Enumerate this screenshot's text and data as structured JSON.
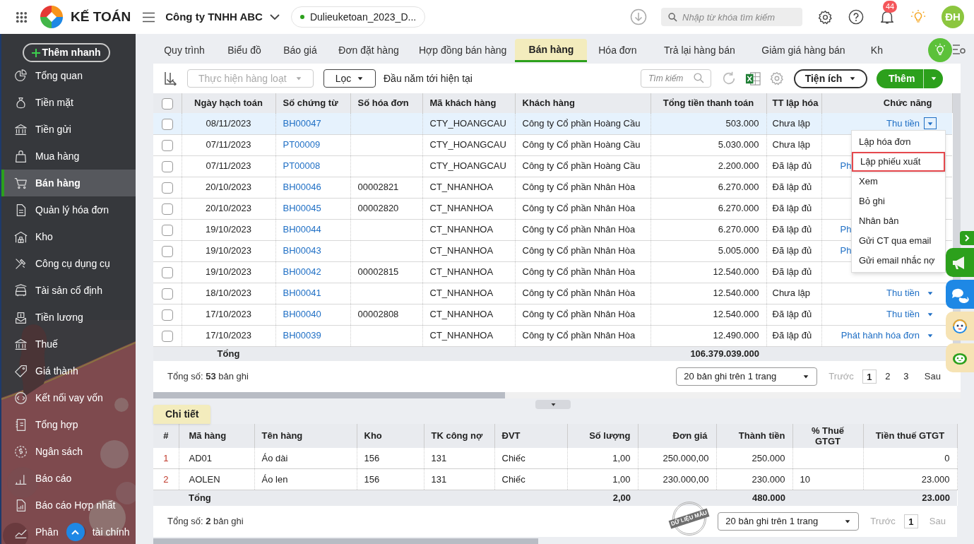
{
  "header": {
    "app_name": "KẾ TOÁN",
    "company": "Công ty TNHH ABC",
    "database": "Dulieuketoan_2023_D...",
    "search_placeholder": "Nhập từ khóa tìm kiếm",
    "notification_count": "44",
    "avatar": "ĐH"
  },
  "sidebar": {
    "quick_add": "Thêm nhanh",
    "items": [
      {
        "label": "Tổng quan",
        "selected": false
      },
      {
        "label": "Tiền mặt",
        "selected": false
      },
      {
        "label": "Tiền gửi",
        "selected": false
      },
      {
        "label": "Mua hàng",
        "selected": false
      },
      {
        "label": "Bán hàng",
        "selected": true
      },
      {
        "label": "Quản lý hóa đơn",
        "selected": false
      },
      {
        "label": "Kho",
        "selected": false
      },
      {
        "label": "Công cụ dụng cụ",
        "selected": false
      },
      {
        "label": "Tài sản cố định",
        "selected": false
      },
      {
        "label": "Tiền lương",
        "selected": false
      },
      {
        "label": "Thuế",
        "selected": false
      },
      {
        "label": "Giá thành",
        "selected": false
      },
      {
        "label": "Kết nối vay vốn",
        "selected": false
      },
      {
        "label": "Tổng hợp",
        "selected": false
      },
      {
        "label": "Ngân sách",
        "selected": false
      },
      {
        "label": "Báo cáo",
        "selected": false
      },
      {
        "label": "Báo cáo Hợp nhất",
        "selected": false
      },
      {
        "label": "Phân",
        "label_after": "tài chính",
        "selected": false
      }
    ]
  },
  "tabs": [
    {
      "label": "Quy trình",
      "selected": false
    },
    {
      "label": "Biểu đồ",
      "selected": false
    },
    {
      "label": "Báo giá",
      "selected": false
    },
    {
      "label": "Đơn đặt hàng",
      "selected": false
    },
    {
      "label": "Hợp đồng bán hàng",
      "selected": false
    },
    {
      "label": "Bán hàng",
      "selected": true
    },
    {
      "label": "Hóa đơn",
      "selected": false
    },
    {
      "label": "Trả lại hàng bán",
      "selected": false
    },
    {
      "label": "Giảm giá hàng bán",
      "selected": false
    },
    {
      "label": "Kh",
      "selected": false
    }
  ],
  "toolbar": {
    "batch": {
      "label": "Thực hiện hàng loạt",
      "disabled": true
    },
    "filter": "Lọc",
    "period": "Đầu năm tới hiện tại",
    "search_placeholder": "Tìm kiếm",
    "utilities": "Tiện ích",
    "add": "Thêm"
  },
  "table": {
    "header_checked": false,
    "columns": [
      "Ngày hạch toán",
      "Số chứng từ",
      "Số hóa đơn",
      "Mã khách hàng",
      "Khách hàng",
      "Tổng tiền thanh toán",
      "TT lập hóa",
      "Chức năng"
    ],
    "rows": [
      {
        "checked": false,
        "selected": true,
        "date": "08/11/2023",
        "doc": "BH00047",
        "invoice": "",
        "customer_code": "CTY_HOANGCAU",
        "customer": "Công ty Cổ phần Hoàng Cầu",
        "total": "503.000",
        "status": "Chưa lập",
        "action": "Thu tiền",
        "menu_open": true
      },
      {
        "checked": false,
        "selected": false,
        "date": "07/11/2023",
        "doc": "PT00009",
        "invoice": "",
        "customer_code": "CTY_HOANGCAU",
        "customer": "Công ty Cổ phần Hoàng Cầu",
        "total": "5.030.000",
        "status": "Chưa lập"
      },
      {
        "checked": false,
        "selected": false,
        "date": "07/11/2023",
        "doc": "PT00008",
        "invoice": "",
        "customer_code": "CTY_HOANGCAU",
        "customer": "Công ty Cổ phần Hoàng Cầu",
        "total": "2.200.000",
        "status": "Đã lập đủ",
        "action": "Ph"
      },
      {
        "checked": false,
        "selected": false,
        "date": "20/10/2023",
        "doc": "BH00046",
        "invoice": "00002821",
        "customer_code": "CT_NHANHOA",
        "customer": "Công ty Cổ phần Nhân Hòa",
        "total": "6.270.000",
        "status": "Đã lập đủ"
      },
      {
        "checked": false,
        "selected": false,
        "date": "20/10/2023",
        "doc": "BH00045",
        "invoice": "00002820",
        "customer_code": "CT_NHANHOA",
        "customer": "Công ty Cổ phần Nhân Hòa",
        "total": "6.270.000",
        "status": "Đã lập đủ"
      },
      {
        "checked": false,
        "selected": false,
        "date": "19/10/2023",
        "doc": "BH00044",
        "invoice": "",
        "customer_code": "CT_NHANHOA",
        "customer": "Công ty Cổ phần Nhân Hòa",
        "total": "6.270.000",
        "status": "Đã lập đủ",
        "action": "Ph"
      },
      {
        "checked": false,
        "selected": false,
        "date": "19/10/2023",
        "doc": "BH00043",
        "invoice": "",
        "customer_code": "CT_NHANHOA",
        "customer": "Công ty Cổ phần Nhân Hòa",
        "total": "5.005.000",
        "status": "Đã lập đủ",
        "action": "Ph"
      },
      {
        "checked": false,
        "selected": false,
        "date": "19/10/2023",
        "doc": "BH00042",
        "invoice": "00002815",
        "customer_code": "CT_NHANHOA",
        "customer": "Công ty Cổ phần Nhân Hòa",
        "total": "12.540.000",
        "status": "Đã lập đủ"
      },
      {
        "checked": false,
        "selected": false,
        "date": "18/10/2023",
        "doc": "BH00041",
        "invoice": "",
        "customer_code": "CT_NHANHOA",
        "customer": "Công ty Cổ phần Nhân Hòa",
        "total": "12.540.000",
        "status": "Chưa lập",
        "action": "Thu tiền",
        "menu_open": false
      },
      {
        "checked": false,
        "selected": false,
        "date": "17/10/2023",
        "doc": "BH00040",
        "invoice": "00002808",
        "customer_code": "CT_NHANHOA",
        "customer": "Công ty Cổ phần Nhân Hòa",
        "total": "12.540.000",
        "status": "Đã lập đủ",
        "action": "Thu tiền",
        "menu_open": false
      },
      {
        "checked": false,
        "selected": false,
        "date": "17/10/2023",
        "doc": "BH00039",
        "invoice": "",
        "customer_code": "CT_NHANHOA",
        "customer": "Công ty Cổ phần Nhân Hòa",
        "total": "12.490.000",
        "status": "Đã lập đủ",
        "action": "Phát hành hóa đơn",
        "menu_open": false
      }
    ],
    "total_label": "Tổng",
    "total_value": "106.379.039.000",
    "record_count": "Tổng số: **53** bản ghi",
    "page_size": "20 bản ghi trên 1 trang",
    "prev": "Trước",
    "pages": [
      {
        "label": "1",
        "selected": true
      },
      {
        "label": "2",
        "selected": false
      },
      {
        "label": "3",
        "selected": false
      }
    ],
    "next": "Sau"
  },
  "action_menu": {
    "items": [
      {
        "label": "Lập hóa đơn",
        "selected": false
      },
      {
        "label": "Lập phiếu xuất",
        "selected": true
      },
      {
        "label": "Xem",
        "selected": false
      },
      {
        "label": "Bỏ ghi",
        "selected": false
      },
      {
        "label": "Nhân bản",
        "selected": false
      },
      {
        "label": "Gửi CT qua email",
        "selected": false
      },
      {
        "label": "Gửi email nhắc nợ",
        "selected": false
      }
    ]
  },
  "detail": {
    "tab": "Chi tiết",
    "columns": [
      "#",
      "Mã hàng",
      "Tên hàng",
      "Kho",
      "TK công nợ",
      "ĐVT",
      "Số lượng",
      "Đơn giá",
      "Thành tiền",
      "% Thuế GTGT",
      "Tiền thuế GTGT"
    ],
    "rows": [
      [
        "1",
        "AD01",
        "Áo dài",
        "156",
        "131",
        "Chiếc",
        "1,00",
        "250.000,00",
        "250.000",
        "",
        "0"
      ],
      [
        "2",
        "AOLEN",
        "Áo len",
        "156",
        "131",
        "Chiếc",
        "1,00",
        "230.000,00",
        "230.000",
        "10",
        "23.000"
      ]
    ],
    "total_label": "Tổng",
    "totals": {
      "quantity": "2,00",
      "amount": "480.000",
      "tax": "23.000"
    },
    "record_count": "Tổng số: **2** bản ghi",
    "stamp": "DỮ LIỆU MẪU",
    "page_size": "20 bản ghi trên 1 trang",
    "prev": "Trước",
    "pages": [
      {
        "label": "1",
        "selected": true
      }
    ],
    "next": "Sau"
  }
}
